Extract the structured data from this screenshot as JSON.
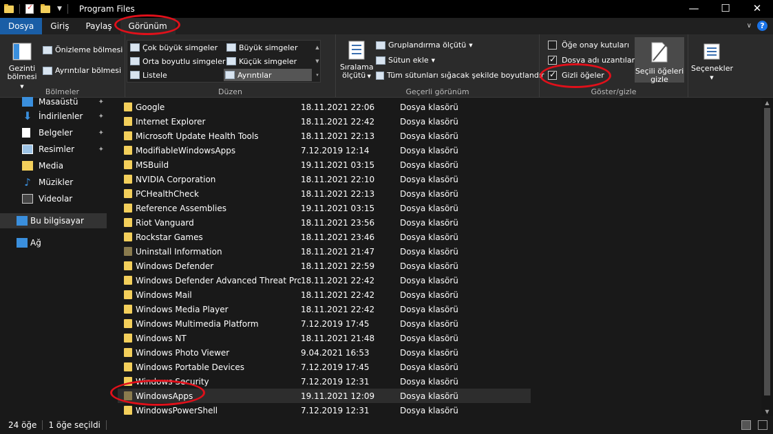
{
  "window": {
    "title": "Program Files",
    "minimize": "—",
    "maximize": "☐",
    "close": "✕"
  },
  "tabs": [
    "Dosya",
    "Giriş",
    "Paylaş",
    "Görünüm"
  ],
  "ribbon": {
    "panes": {
      "nav_pane": "Gezinti bölmesi",
      "preview": "Önizleme bölmesi",
      "details": "Ayrıntılar bölmesi",
      "label": "Bölmeler"
    },
    "layout": {
      "items": [
        "Çok büyük simgeler",
        "Büyük simgeler",
        "Orta boyutlu simgeler",
        "Küçük simgeler",
        "Listele",
        "Ayrıntılar"
      ],
      "selected": "Ayrıntılar",
      "label": "Düzen"
    },
    "current_view": {
      "sort_by": "Sıralama ölçütü",
      "group_by": "Gruplandırma ölçütü",
      "add_columns": "Sütun ekle",
      "fit_columns": "Tüm sütunları sığacak şekilde boyutlandır",
      "label": "Geçerli görünüm"
    },
    "show_hide": {
      "item_checkboxes": {
        "label": "Öğe onay kutuları",
        "checked": false
      },
      "file_extensions": {
        "label": "Dosya adı uzantıları",
        "checked": true
      },
      "hidden_items": {
        "label": "Gizli öğeler",
        "checked": true
      },
      "hide_selected": "Seçili öğeleri gizle",
      "label": "Göster/gizle"
    },
    "options": "Seçenekler"
  },
  "nav": {
    "items": [
      {
        "label": "Masaüstü",
        "pinned": true
      },
      {
        "label": "İndirilenler",
        "pinned": true
      },
      {
        "label": "Belgeler",
        "pinned": true
      },
      {
        "label": "Resimler",
        "pinned": true
      },
      {
        "label": "Media",
        "pinned": false
      },
      {
        "label": "Müzikler",
        "pinned": false
      },
      {
        "label": "Videolar",
        "pinned": false
      },
      {
        "label": "Bu bilgisayar",
        "pinned": false,
        "selected": true
      },
      {
        "label": "Ağ",
        "pinned": false
      }
    ]
  },
  "files": [
    {
      "name": "Google",
      "date": "18.11.2021 22:06",
      "type": "Dosya klasörü",
      "hidden": false
    },
    {
      "name": "Internet Explorer",
      "date": "18.11.2021 22:42",
      "type": "Dosya klasörü",
      "hidden": false
    },
    {
      "name": "Microsoft Update Health Tools",
      "date": "18.11.2021 22:13",
      "type": "Dosya klasörü",
      "hidden": false
    },
    {
      "name": "ModifiableWindowsApps",
      "date": "7.12.2019 12:14",
      "type": "Dosya klasörü",
      "hidden": false
    },
    {
      "name": "MSBuild",
      "date": "19.11.2021 03:15",
      "type": "Dosya klasörü",
      "hidden": false
    },
    {
      "name": "NVIDIA Corporation",
      "date": "18.11.2021 22:10",
      "type": "Dosya klasörü",
      "hidden": false
    },
    {
      "name": "PCHealthCheck",
      "date": "18.11.2021 22:13",
      "type": "Dosya klasörü",
      "hidden": false
    },
    {
      "name": "Reference Assemblies",
      "date": "19.11.2021 03:15",
      "type": "Dosya klasörü",
      "hidden": false
    },
    {
      "name": "Riot Vanguard",
      "date": "18.11.2021 23:56",
      "type": "Dosya klasörü",
      "hidden": false
    },
    {
      "name": "Rockstar Games",
      "date": "18.11.2021 23:46",
      "type": "Dosya klasörü",
      "hidden": false
    },
    {
      "name": "Uninstall Information",
      "date": "18.11.2021 21:47",
      "type": "Dosya klasörü",
      "hidden": true
    },
    {
      "name": "Windows Defender",
      "date": "18.11.2021 22:59",
      "type": "Dosya klasörü",
      "hidden": false
    },
    {
      "name": "Windows Defender Advanced Threat Prot...",
      "date": "18.11.2021 22:42",
      "type": "Dosya klasörü",
      "hidden": false
    },
    {
      "name": "Windows Mail",
      "date": "18.11.2021 22:42",
      "type": "Dosya klasörü",
      "hidden": false
    },
    {
      "name": "Windows Media Player",
      "date": "18.11.2021 22:42",
      "type": "Dosya klasörü",
      "hidden": false
    },
    {
      "name": "Windows Multimedia Platform",
      "date": "7.12.2019 17:45",
      "type": "Dosya klasörü",
      "hidden": false
    },
    {
      "name": "Windows NT",
      "date": "18.11.2021 21:48",
      "type": "Dosya klasörü",
      "hidden": false
    },
    {
      "name": "Windows Photo Viewer",
      "date": "9.04.2021 16:53",
      "type": "Dosya klasörü",
      "hidden": false
    },
    {
      "name": "Windows Portable Devices",
      "date": "7.12.2019 17:45",
      "type": "Dosya klasörü",
      "hidden": false
    },
    {
      "name": "Windows Security",
      "date": "7.12.2019 12:31",
      "type": "Dosya klasörü",
      "hidden": false
    },
    {
      "name": "WindowsApps",
      "date": "19.11.2021 12:09",
      "type": "Dosya klasörü",
      "hidden": true,
      "selected": true
    },
    {
      "name": "WindowsPowerShell",
      "date": "7.12.2019 12:31",
      "type": "Dosya klasörü",
      "hidden": false
    }
  ],
  "status": {
    "count": "24 öğe",
    "selected": "1 öğe seçildi"
  },
  "colors": {
    "accent": "#1a5ea6",
    "annotation": "#e0101a",
    "folder": "#f3cf5b"
  }
}
